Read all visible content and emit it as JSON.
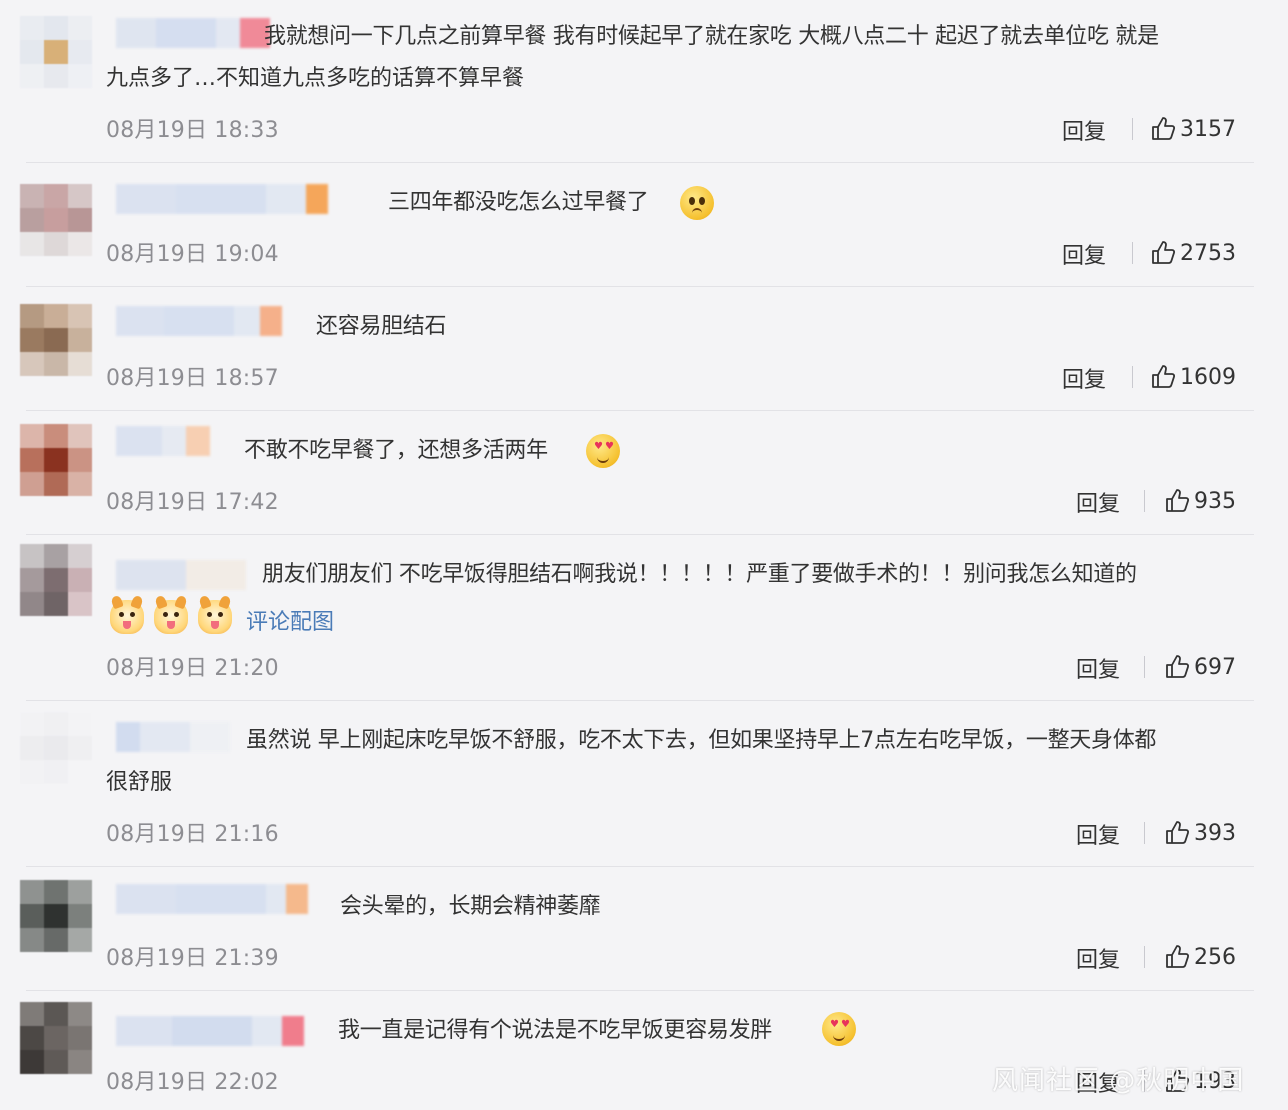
{
  "ui": {
    "reply_label": "回复",
    "link_color": "#4a7bb7",
    "time_color": "#8d8d92"
  },
  "comments": [
    {
      "line1": "我就想问一下几点之前算早餐 我有时候起早了就在家吃 大概八点二十 起迟了就去单位吃 就是",
      "line2": "九点多了…不知道九点多吃的话算不算早餐",
      "time": "08月19日 18:33",
      "likes": "3157"
    },
    {
      "line1": "三四年都没吃怎么过早餐了",
      "emoji": "worried-face-emoji",
      "time": "08月19日 19:04",
      "likes": "2753"
    },
    {
      "line1": "还容易胆结石",
      "time": "08月19日 18:57",
      "likes": "1609"
    },
    {
      "line1": "不敢不吃早餐了，还想多活两年",
      "emoji": "heart-eyes-emoji",
      "time": "08月19日 17:42",
      "likes": "935"
    },
    {
      "line1": "朋友们朋友们 不吃早饭得胆结石啊我说！！！！！严重了要做手术的！！别问我怎么知道的",
      "emoji": "dog-emoji",
      "image_link": "评论配图",
      "time": "08月19日 21:20",
      "likes": "697"
    },
    {
      "line1": "虽然说 早上刚起床吃早饭不舒服，吃不太下去，但如果坚持早上7点左右吃早饭，一整天身体都",
      "line2": "很舒服",
      "time": "08月19日 21:16",
      "likes": "393"
    },
    {
      "line1": "会头晕的，长期会精神萎靡",
      "time": "08月19日 21:39",
      "likes": "256"
    },
    {
      "line1": "我一直是记得有个说法是不吃早饭更容易发胖",
      "emoji": "heart-eyes-emoji",
      "time": "08月19日 22:02",
      "likes": "193"
    }
  ],
  "watermark": "风闻社区 @秋明中国"
}
